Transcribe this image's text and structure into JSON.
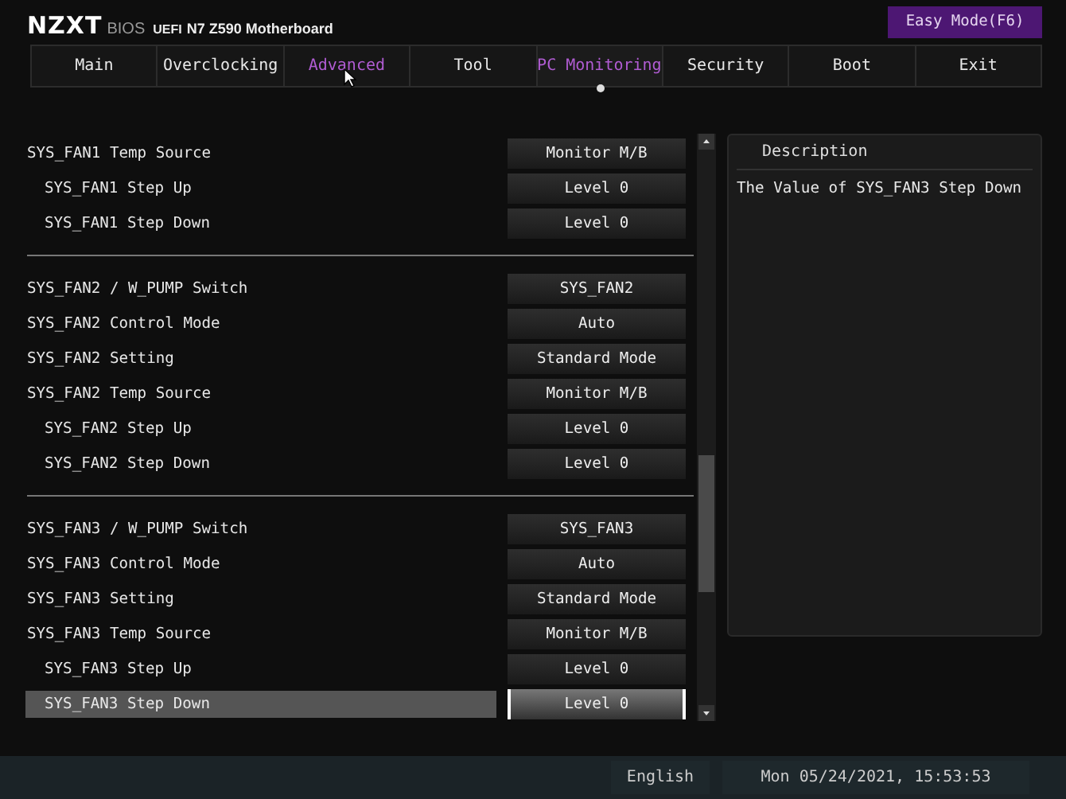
{
  "header": {
    "brand": "NZXT",
    "bios": "BIOS",
    "uefi": "UEFI",
    "model": "N7 Z590 Motherboard",
    "easy_mode": "Easy Mode(F6)"
  },
  "tabs": [
    {
      "label": "Main",
      "selected": false,
      "hovered": false
    },
    {
      "label": "Overclocking",
      "selected": false,
      "hovered": false
    },
    {
      "label": "Advanced",
      "selected": false,
      "hovered": true
    },
    {
      "label": "Tool",
      "selected": false,
      "hovered": false
    },
    {
      "label": "PC Monitoring",
      "selected": true,
      "hovered": false
    },
    {
      "label": "Security",
      "selected": false,
      "hovered": false
    },
    {
      "label": "Boot",
      "selected": false,
      "hovered": false
    },
    {
      "label": "Exit",
      "selected": false,
      "hovered": false
    }
  ],
  "sections": [
    {
      "rows": [
        {
          "label": "SYS_FAN1 Temp Source",
          "value": "Monitor M/B",
          "kind": "item",
          "selected": false
        },
        {
          "label": "SYS_FAN1 Step Up",
          "value": "Level 0",
          "kind": "sub",
          "selected": false
        },
        {
          "label": "SYS_FAN1 Step Down",
          "value": "Level 0",
          "kind": "sub",
          "selected": false
        }
      ]
    },
    {
      "rows": [
        {
          "label": "SYS_FAN2 / W_PUMP Switch",
          "value": "SYS_FAN2",
          "kind": "item",
          "selected": false
        },
        {
          "label": "SYS_FAN2 Control Mode",
          "value": "Auto",
          "kind": "item",
          "selected": false
        },
        {
          "label": "SYS_FAN2 Setting",
          "value": "Standard Mode",
          "kind": "item",
          "selected": false
        },
        {
          "label": "SYS_FAN2 Temp Source",
          "value": "Monitor M/B",
          "kind": "item",
          "selected": false
        },
        {
          "label": "SYS_FAN2 Step Up",
          "value": "Level 0",
          "kind": "sub",
          "selected": false
        },
        {
          "label": "SYS_FAN2 Step Down",
          "value": "Level 0",
          "kind": "sub",
          "selected": false
        }
      ]
    },
    {
      "rows": [
        {
          "label": "SYS_FAN3 / W_PUMP Switch",
          "value": "SYS_FAN3",
          "kind": "item",
          "selected": false
        },
        {
          "label": "SYS_FAN3 Control Mode",
          "value": "Auto",
          "kind": "item",
          "selected": false
        },
        {
          "label": "SYS_FAN3 Setting",
          "value": "Standard Mode",
          "kind": "item",
          "selected": false
        },
        {
          "label": "SYS_FAN3 Temp Source",
          "value": "Monitor M/B",
          "kind": "item",
          "selected": false
        },
        {
          "label": "SYS_FAN3 Step Up",
          "value": "Level 0",
          "kind": "sub",
          "selected": false
        },
        {
          "label": "SYS_FAN3 Step Down",
          "value": "Level 0",
          "kind": "sub",
          "selected": true
        }
      ]
    }
  ],
  "description": {
    "title": "Description",
    "text": "The Value of SYS_FAN3 Step Down"
  },
  "status_bar": {
    "language": "English",
    "datetime": "Mon 05/24/2021, 15:53:53"
  }
}
